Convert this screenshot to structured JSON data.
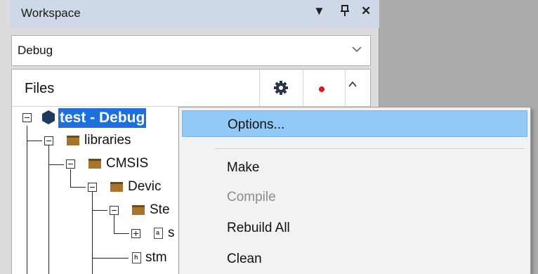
{
  "workspace": {
    "title": "Workspace",
    "pin_glyph": "▼",
    "dock_glyph": "⊥",
    "close_glyph": "✕"
  },
  "config_select": {
    "value": "Debug"
  },
  "files": {
    "header": "Files",
    "tree": {
      "project": "test - Debug",
      "libraries": "libraries",
      "cmsis": "CMSIS",
      "device": "Devic",
      "st": "Ste",
      "file1": "s",
      "file2": "stm"
    }
  },
  "context_menu": {
    "items": [
      {
        "label": "Options...",
        "state": "highlighted"
      },
      {
        "label": "Make",
        "state": "normal"
      },
      {
        "label": "Compile",
        "state": "disabled"
      },
      {
        "label": "Rebuild All",
        "state": "normal"
      },
      {
        "label": "Clean",
        "state": "normal"
      }
    ]
  },
  "colors": {
    "selection": "#1e6fd9",
    "menu_highlight": "#91c9f7",
    "folder": "#a8742c",
    "status_dot": "#e8121b"
  }
}
